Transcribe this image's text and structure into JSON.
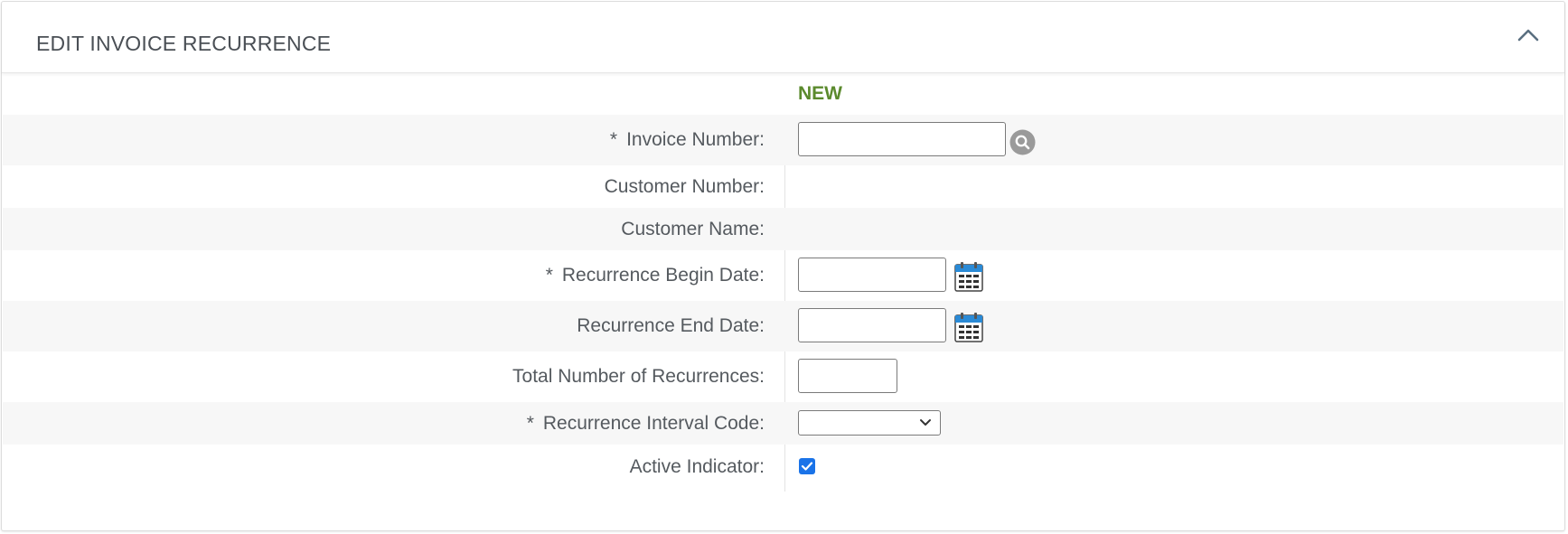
{
  "panel": {
    "title": "EDIT INVOICE RECURRENCE",
    "collapse_icon": "chevron-up-icon",
    "status": "NEW"
  },
  "fields": {
    "invoice_number": {
      "label": "Invoice Number:",
      "required_mark": "*",
      "value": ""
    },
    "customer_number": {
      "label": "Customer Number:",
      "value": ""
    },
    "customer_name": {
      "label": "Customer Name:",
      "value": ""
    },
    "recurrence_begin_date": {
      "label": "Recurrence Begin Date:",
      "required_mark": "*",
      "value": ""
    },
    "recurrence_end_date": {
      "label": "Recurrence End Date:",
      "value": ""
    },
    "total_recurrences": {
      "label": "Total Number of Recurrences:",
      "value": ""
    },
    "recurrence_interval_code": {
      "label": "Recurrence Interval Code:",
      "required_mark": "*",
      "selected": ""
    },
    "active_indicator": {
      "label": "Active Indicator:",
      "checked": true
    }
  },
  "colors": {
    "status_green": "#5b8a2d",
    "row_shade": "#f7f7f7",
    "checkbox_blue": "#1a73e8",
    "calendar_blue": "#2a8ad6"
  },
  "icons": {
    "search": "search-icon",
    "calendar": "calendar-icon",
    "chevron": "chevron-up-icon",
    "select_arrow": "chevron-down-icon"
  }
}
